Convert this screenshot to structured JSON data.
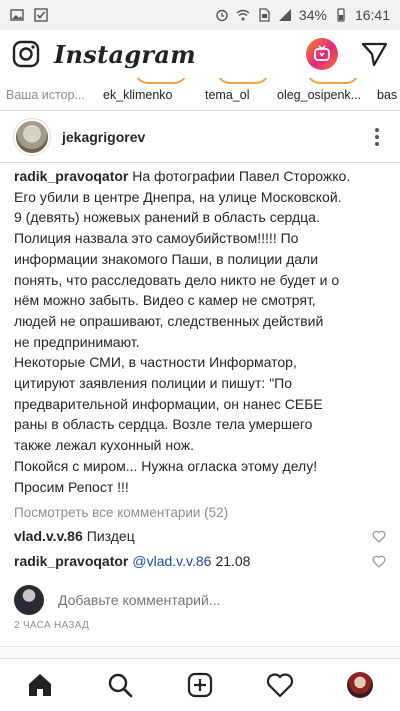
{
  "status_bar": {
    "battery": "34%",
    "time": "16:41"
  },
  "app": {
    "title": "Instagram"
  },
  "stories": [
    {
      "label": "Ваша истор...",
      "own": true
    },
    {
      "label": "ek_klimenko"
    },
    {
      "label": "tema_ol"
    },
    {
      "label": "oleg_osipenk..."
    },
    {
      "label": "bas"
    }
  ],
  "post": {
    "author": "jekagrigorev",
    "caption_user": "radik_pravoqator",
    "caption_lines": [
      "На фотографии Павел Сторожко.",
      "Его убили в центре Днепра, на улице Московской.",
      "9 (девять) ножевых ранений в область сердца.",
      "Полиция назвала это самоубийством!!!!! По",
      "информации знакомого Паши, в полиции дали",
      "понять, что расследовать дело никто не будет и о",
      "нём можно забыть. Видео с камер не смотрят,",
      "людей не опрашивают, следственных действий",
      "не предпринимают.",
      "Некоторые СМИ, в частности Информатор,",
      "цитируют заявления полиции и пишут: \"По",
      "предварительной информации, он нанес СЕБЕ",
      "раны в область сердца. Возле тела умершего",
      "также лежал кухонный нож.",
      "Покойся с миром... Нужна огласка этому делу!",
      "Просим Репост !!!"
    ],
    "view_all_comments": "Посмотреть все комментарии (52)",
    "comments": [
      {
        "user": "vlad.v.v.86",
        "mention": "",
        "text": "Пиздец"
      },
      {
        "user": "radik_pravoqator",
        "mention": "@vlad.v.v.86",
        "text": "21.08"
      }
    ],
    "add_comment_placeholder": "Добавьте комментарий...",
    "timestamp": "2 ЧАСА НАЗАД"
  },
  "icons": {
    "header": [
      "camera-icon",
      "igtv-icon",
      "direct-icon"
    ],
    "nav": [
      "home-icon",
      "search-icon",
      "new-post-icon",
      "activity-icon",
      "profile-avatar"
    ]
  },
  "colors": {
    "igtv_gradient_start": "#f58529",
    "igtv_gradient_end": "#dd2a7b",
    "mention": "#1d4e89",
    "muted": "#8e8e8e"
  }
}
